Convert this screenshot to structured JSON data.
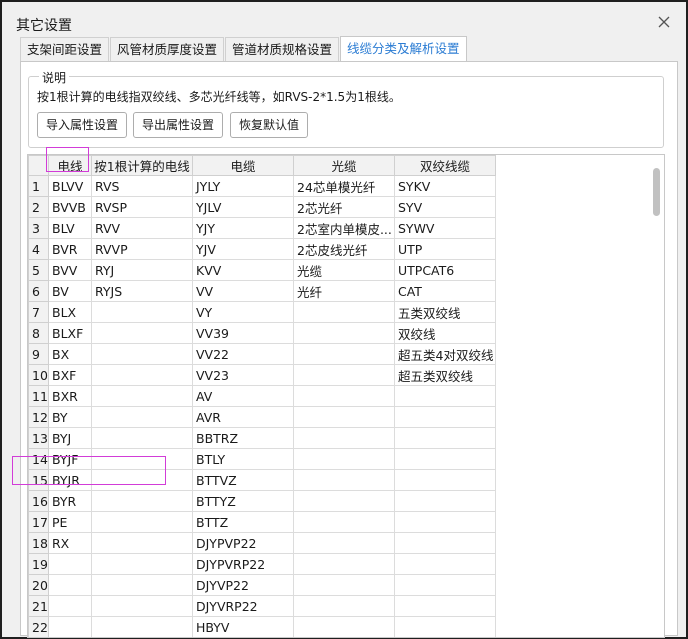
{
  "window": {
    "title": "其它设置"
  },
  "tabs": [
    {
      "label": "支架间距设置"
    },
    {
      "label": "风管材质厚度设置"
    },
    {
      "label": "管道材质规格设置"
    },
    {
      "label": "线缆分类及解析设置"
    }
  ],
  "explain": {
    "legend": "说明",
    "text": "按1根计算的电线指双绞线、多芯光纤线等，如RVS-2*1.5为1根线。",
    "import_label": "导入属性设置",
    "export_label": "导出属性设置",
    "reset_label": "恢复默认值"
  },
  "grid": {
    "columns": [
      "",
      "电线",
      "按1根计算的电线",
      "电缆",
      "光缆",
      "双绞线缆"
    ],
    "rows": [
      [
        "1",
        "BLVV",
        "RVS",
        "JYLY",
        "24芯单模光纤",
        "SYKV"
      ],
      [
        "2",
        "BVVB",
        "RVSP",
        "YJLV",
        "2芯光纤",
        "SYV"
      ],
      [
        "3",
        "BLV",
        "RVV",
        "YJY",
        "2芯室内单模皮...",
        "SYWV"
      ],
      [
        "4",
        "BVR",
        "RVVP",
        "YJV",
        "2芯皮线光纤",
        "UTP"
      ],
      [
        "5",
        "BVV",
        "RYJ",
        "KVV",
        "光缆",
        "UTPCAT6"
      ],
      [
        "6",
        "BV",
        "RYJS",
        "VV",
        "光纤",
        "CAT"
      ],
      [
        "7",
        "BLX",
        "",
        "VY",
        "",
        "五类双绞线"
      ],
      [
        "8",
        "BLXF",
        "",
        "VV39",
        "",
        "双绞线"
      ],
      [
        "9",
        "BX",
        "",
        "VV22",
        "",
        "超五类4对双绞线"
      ],
      [
        "10",
        "BXF",
        "",
        "VV23",
        "",
        "超五类双绞线"
      ],
      [
        "11",
        "BXR",
        "",
        "AV",
        "",
        ""
      ],
      [
        "12",
        "BY",
        "",
        "AVR",
        "",
        ""
      ],
      [
        "13",
        "BYJ",
        "",
        "BBTRZ",
        "",
        ""
      ],
      [
        "14",
        "BYJF",
        "",
        "BTLY",
        "",
        ""
      ],
      [
        "15",
        "BYJR",
        "",
        "BTTVZ",
        "",
        ""
      ],
      [
        "16",
        "BYR",
        "",
        "BTTYZ",
        "",
        ""
      ],
      [
        "17",
        "PE",
        "",
        "BTTZ",
        "",
        ""
      ],
      [
        "18",
        "RX",
        "",
        "DJYPVP22",
        "",
        ""
      ],
      [
        "19",
        "",
        "",
        "DJYPVRP22",
        "",
        ""
      ],
      [
        "20",
        "",
        "",
        "DJYVP22",
        "",
        ""
      ],
      [
        "21",
        "",
        "",
        "DJYVRP22",
        "",
        ""
      ],
      [
        "22",
        "",
        "",
        "HBYV",
        "",
        ""
      ]
    ]
  },
  "icons": {
    "close": "close-icon"
  },
  "colors": {
    "active_tab": "#2b7cd3",
    "highlight": "#d23cd8"
  }
}
